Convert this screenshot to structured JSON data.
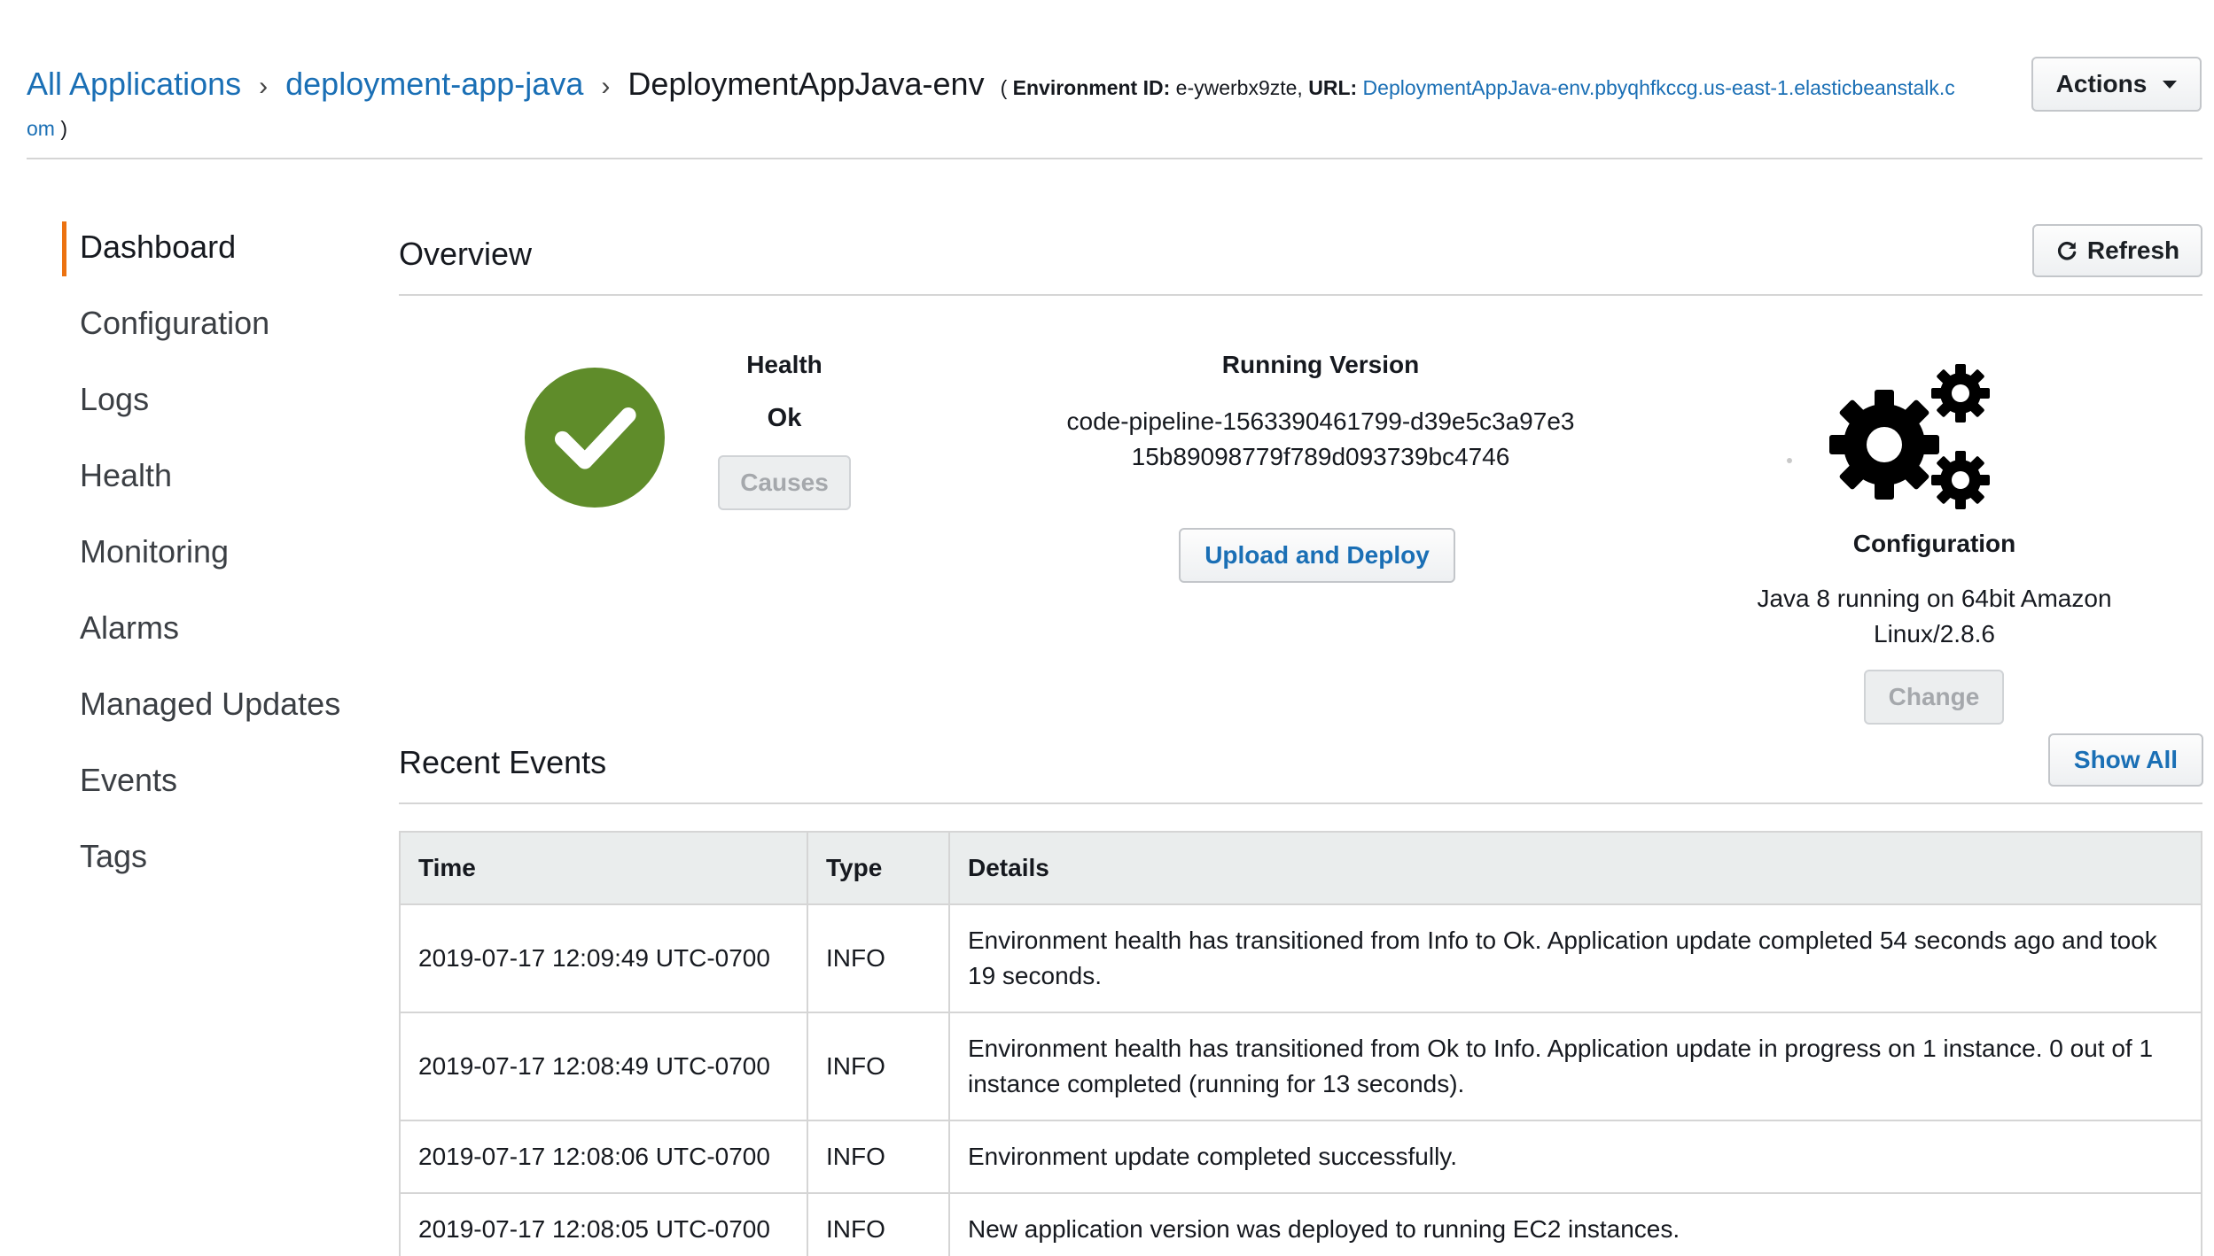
{
  "breadcrumb": {
    "all_applications": "All Applications",
    "application": "deployment-app-java",
    "environment": "DeploymentAppJava-env",
    "open_paren": "(",
    "env_id_label": "Environment ID:",
    "env_id_value": "e-ywerbx9zte,",
    "url_label": "URL:",
    "url_part1": "DeploymentAppJava-env.pbyqhfkccg.us-east-1.elasticbeanstalk.c",
    "url_part2": "om",
    "close_paren": ")"
  },
  "actions_button": {
    "label": "Actions"
  },
  "sidebar": {
    "items": [
      {
        "label": "Dashboard",
        "active": true
      },
      {
        "label": "Configuration"
      },
      {
        "label": "Logs"
      },
      {
        "label": "Health"
      },
      {
        "label": "Monitoring"
      },
      {
        "label": "Alarms"
      },
      {
        "label": "Managed Updates"
      },
      {
        "label": "Events"
      },
      {
        "label": "Tags"
      }
    ]
  },
  "overview": {
    "title": "Overview",
    "refresh_label": "Refresh",
    "health": {
      "title": "Health",
      "value": "Ok",
      "causes_label": "Causes",
      "status_color": "#5f8c2a"
    },
    "running_version": {
      "title": "Running Version",
      "value": "code-pipeline-1563390461799-d39e5c3a97e315b89098779f789d093739bc4746",
      "upload_label": "Upload and Deploy"
    },
    "configuration": {
      "title": "Configuration",
      "value": "Java 8 running on 64bit Amazon Linux/2.8.6",
      "change_label": "Change",
      "icon": "gears-icon"
    }
  },
  "recent_events": {
    "title": "Recent Events",
    "show_all_label": "Show All",
    "columns": [
      "Time",
      "Type",
      "Details"
    ],
    "rows": [
      {
        "time": "2019-07-17 12:09:49 UTC-0700",
        "type": "INFO",
        "details": "Environment health has transitioned from Info to Ok. Application update completed 54 seconds ago and took 19 seconds."
      },
      {
        "time": "2019-07-17 12:08:49 UTC-0700",
        "type": "INFO",
        "details": "Environment health has transitioned from Ok to Info. Application update in progress on 1 instance. 0 out of 1 instance completed (running for 13 seconds)."
      },
      {
        "time": "2019-07-17 12:08:06 UTC-0700",
        "type": "INFO",
        "details": "Environment update completed successfully."
      },
      {
        "time": "2019-07-17 12:08:05 UTC-0700",
        "type": "INFO",
        "details": "New application version was deployed to running EC2 instances."
      }
    ]
  },
  "colors": {
    "link": "#1a6fb5",
    "accent": "#ec7211",
    "info": "#5c8a1e"
  }
}
